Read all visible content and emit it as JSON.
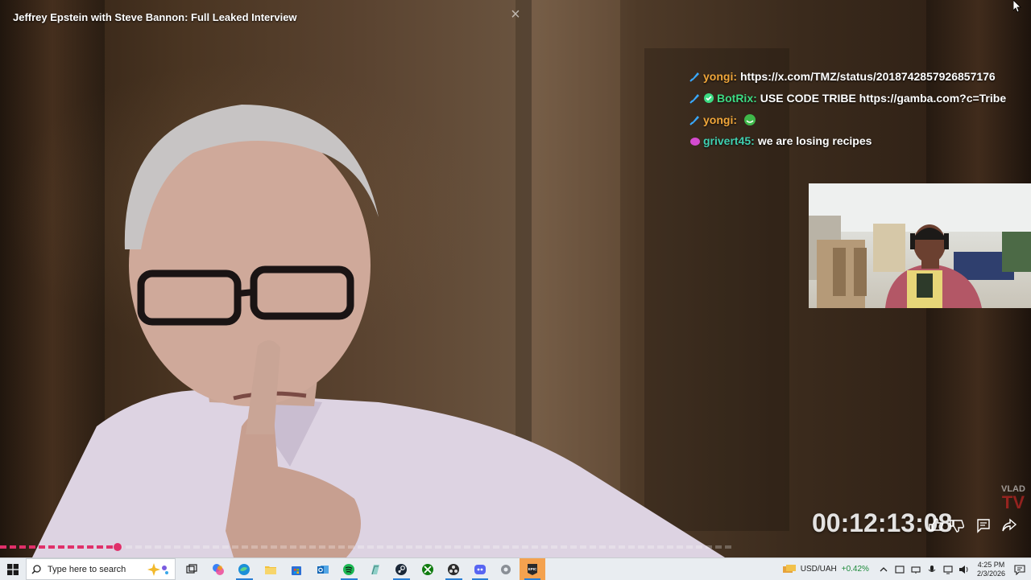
{
  "video": {
    "title": "Jeffrey Epstein with Steve Bannon: Full Leaked Interview",
    "timer": "00:12:13:08",
    "progress_fraction": 0.16
  },
  "watermark": {
    "line1": "VLAD",
    "line2": "TV"
  },
  "chat": {
    "messages": [
      {
        "badges": [
          "sword-badge"
        ],
        "user": "yongi:",
        "user_color": "#f0a63a",
        "text": "https://x.com/TMZ/status/2018742857926857176",
        "emote": null
      },
      {
        "badges": [
          "sword-badge",
          "verified-badge"
        ],
        "user": "BotRix:",
        "user_color": "#3ddc84",
        "text": "USE CODE TRIBE https://gamba.com?c=Tribe",
        "emote": null
      },
      {
        "badges": [
          "sword-badge"
        ],
        "user": "yongi:",
        "user_color": "#f0a63a",
        "text": "",
        "emote": "green-face-emote"
      },
      {
        "badges": [
          "crown-badge"
        ],
        "user": "grivert45:",
        "user_color": "#3fcfb0",
        "text": "we are losing recipes",
        "emote": null
      }
    ]
  },
  "taskbar": {
    "search_placeholder": "Type here to search",
    "apps": [
      "task-view-icon",
      "copilot-icon",
      "edge-icon",
      "file-explorer-icon",
      "store-icon",
      "outlook-icon",
      "spotify-icon",
      "notepad-icon",
      "steam-icon",
      "xbox-icon",
      "obs-icon",
      "discord-icon",
      "settings-icon",
      "epic-games-icon"
    ],
    "active_app": "epic-games-icon",
    "stock": {
      "symbol": "USD/UAH",
      "change": "+0.42%"
    },
    "clock": {
      "time": "4:25 PM",
      "date": "2/3/2026"
    }
  },
  "colors": {
    "accent": "#e0306a",
    "taskbar_bg": "#e9edf1"
  }
}
